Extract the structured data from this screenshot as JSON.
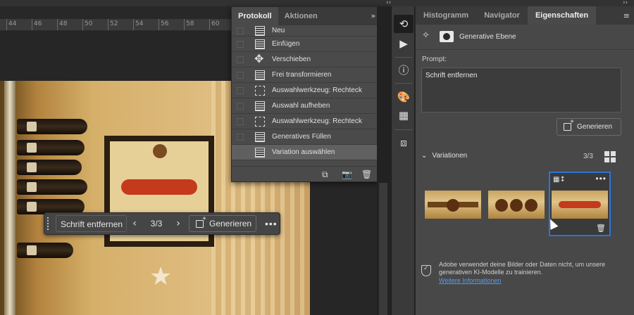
{
  "canvas": {
    "ruler_ticks": [
      "44",
      "46",
      "48",
      "50",
      "52",
      "54",
      "56",
      "58",
      "60"
    ]
  },
  "taskbar": {
    "prompt": "Schrift entfernen",
    "prev_icon": "‹",
    "next_icon": "›",
    "count": "3/3",
    "generate_label": "Generieren",
    "more_label": "•••"
  },
  "history": {
    "tabs": [
      "Protokoll",
      "Aktionen"
    ],
    "tools_label": "»  ≡",
    "items": [
      {
        "label": "Neu",
        "icon": "doc-icon"
      },
      {
        "label": "Einfügen",
        "icon": "doc-icon"
      },
      {
        "label": "Verschieben",
        "icon": "move-icon"
      },
      {
        "label": "Frei transformieren",
        "icon": "doc-icon"
      },
      {
        "label": "Auswahlwerkzeug: Rechteck",
        "icon": "marquee-icon"
      },
      {
        "label": "Auswahl aufheben",
        "icon": "doc-icon"
      },
      {
        "label": "Auswahlwerkzeug: Rechteck",
        "icon": "marquee-icon"
      },
      {
        "label": "Generatives Füllen",
        "icon": "doc-icon"
      },
      {
        "label": "Variation auswählen",
        "icon": "doc-icon"
      }
    ],
    "selected_index": 8
  },
  "properties": {
    "tabs": [
      "Histogramm",
      "Navigator",
      "Eigenschaften"
    ],
    "active_tab": "Eigenschaften",
    "layer_name": "Generative Ebene",
    "prompt_label": "Prompt:",
    "prompt_value": "Schrift entfernen",
    "generate_label": "Generieren",
    "variations_label": "Variationen",
    "variations_count": "3/3",
    "notice_text": "Adobe verwendet deine Bilder oder Daten nicht, um unsere generativen KI-Modelle zu trainieren.",
    "notice_link": "Weitere Informationen"
  },
  "colors": {
    "accent_blue": "#2d75d6",
    "link_blue": "#5b9bef",
    "panel_bg": "#484848"
  }
}
